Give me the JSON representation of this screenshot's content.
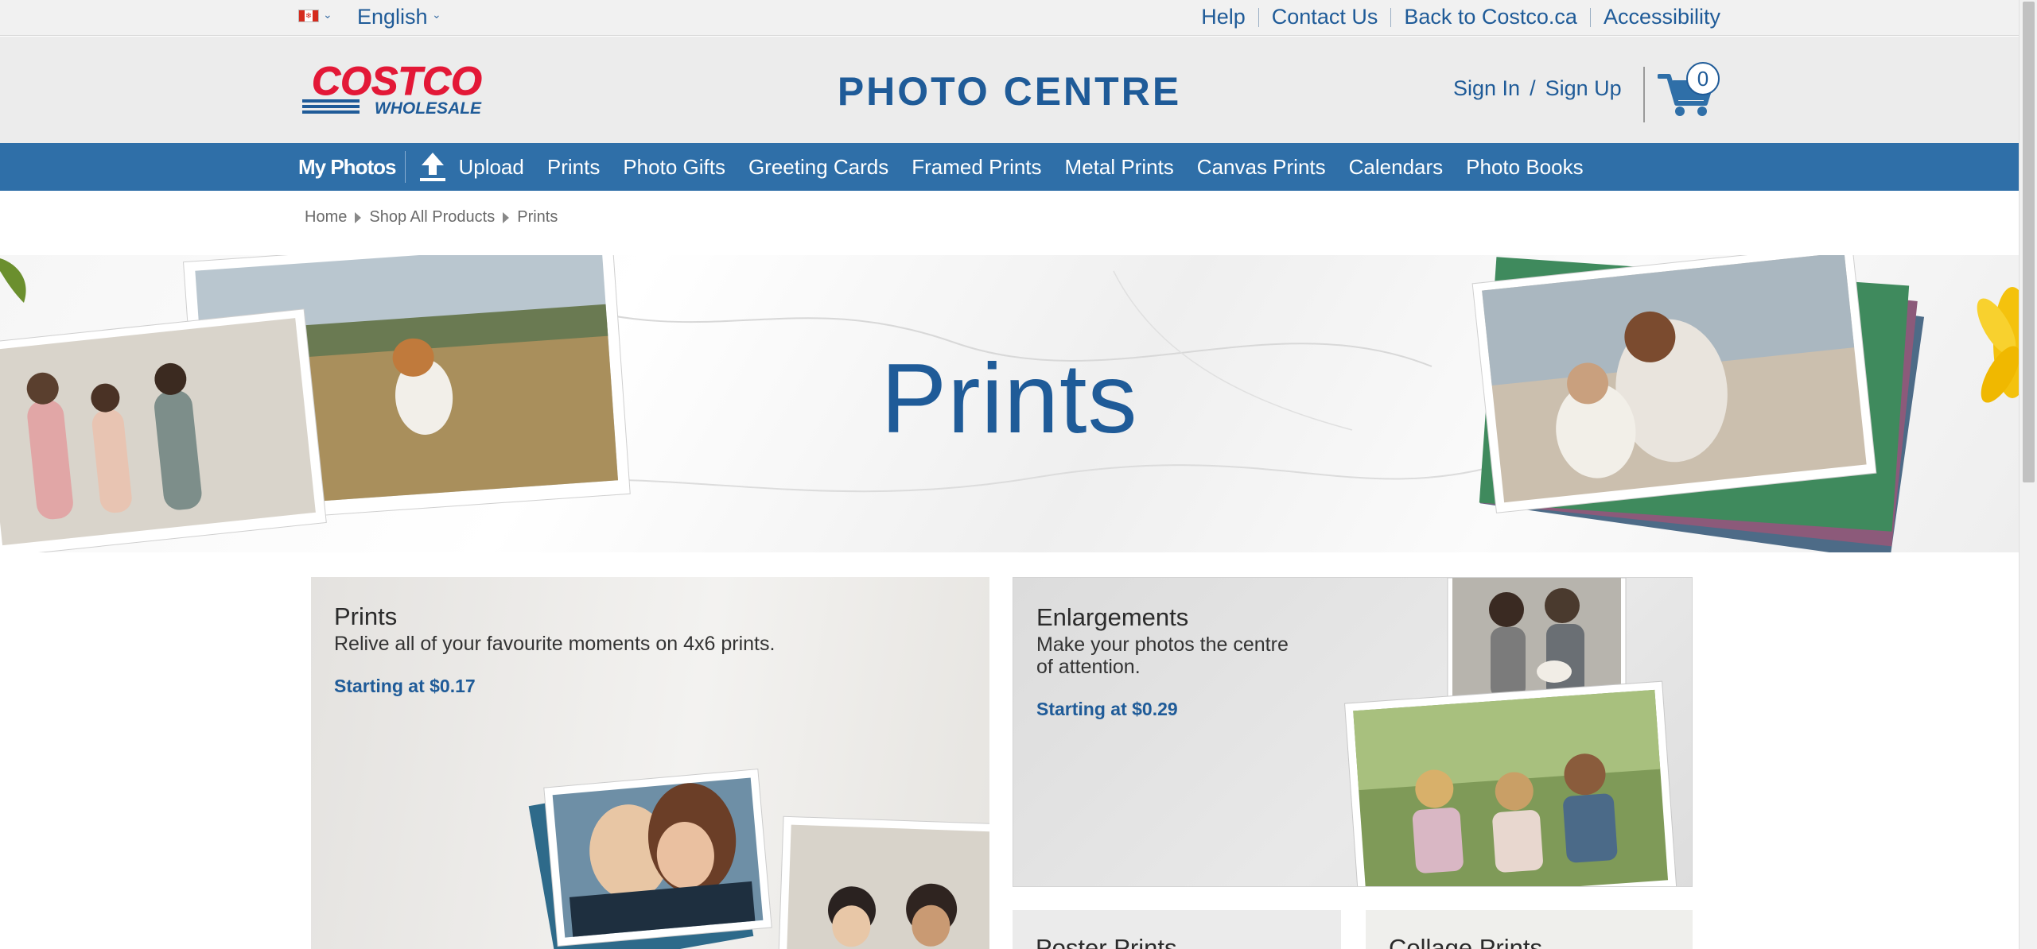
{
  "utility": {
    "language": "English",
    "links": [
      "Help",
      "Contact Us",
      "Back to Costco.ca",
      "Accessibility"
    ]
  },
  "header": {
    "logo_top": "COSTCO",
    "logo_bottom": "WHOLESALE",
    "site_title": "PHOTO CENTRE",
    "sign_in": "Sign In",
    "auth_sep": "/",
    "sign_up": "Sign Up",
    "cart_count": "0"
  },
  "nav": {
    "active": "My Photos",
    "upload": "Upload",
    "items": [
      "Prints",
      "Photo Gifts",
      "Greeting Cards",
      "Framed Prints",
      "Metal Prints",
      "Canvas Prints",
      "Calendars",
      "Photo Books"
    ]
  },
  "breadcrumb": [
    "Home",
    "Shop All Products",
    "Prints"
  ],
  "hero": {
    "title": "Prints"
  },
  "tiles": {
    "prints": {
      "title": "Prints",
      "desc": "Relive all of your favourite moments on 4x6 prints.",
      "price": "Starting at $0.17"
    },
    "enlargements": {
      "title": "Enlargements",
      "desc_line1": "Make your photos the centre",
      "desc_line2": "of attention.",
      "price": "Starting at $0.29"
    },
    "poster": {
      "title": "Poster Prints"
    },
    "collage": {
      "title": "Collage Prints"
    }
  },
  "colors": {
    "brand_blue": "#1f5b98",
    "nav_blue": "#2f6fa8",
    "costco_red": "#e31837"
  },
  "icons": [
    "canada-flag-icon",
    "chevron-down-icon",
    "cart-icon",
    "upload-icon",
    "breadcrumb-arrow-icon"
  ]
}
